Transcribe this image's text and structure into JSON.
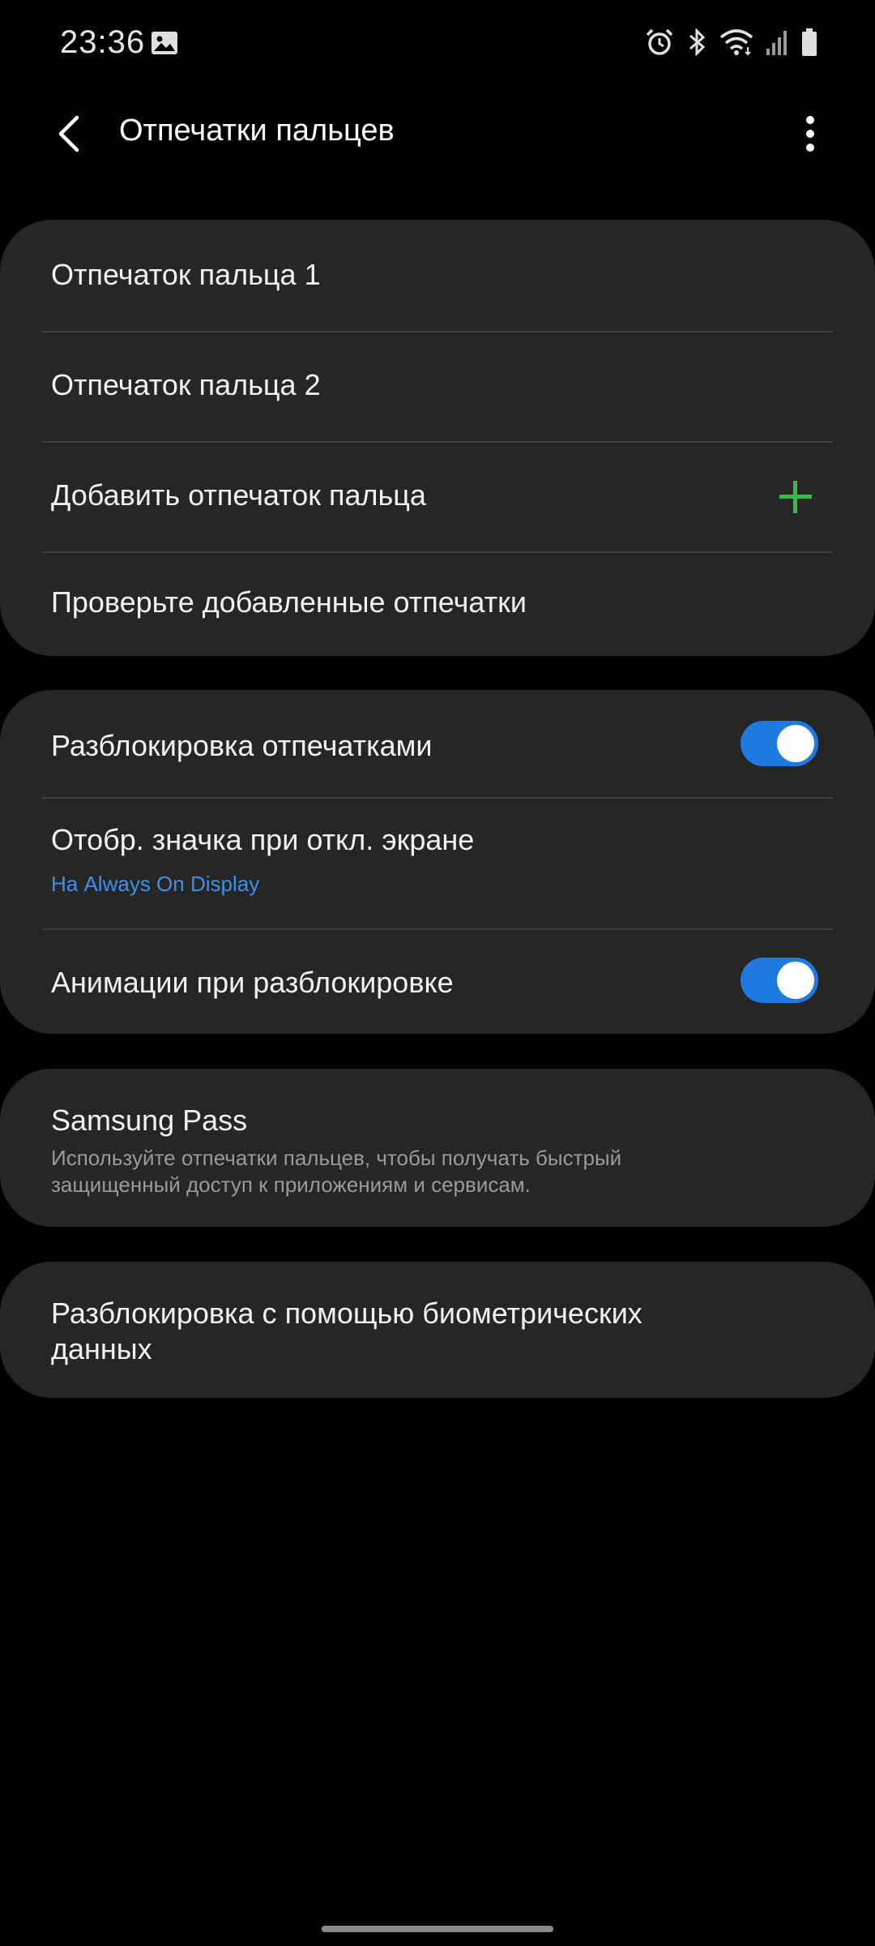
{
  "status_bar": {
    "time": "23:36",
    "icons": [
      "image-icon",
      "alarm-icon",
      "bluetooth-icon",
      "wifi-icon",
      "signal-icon",
      "battery-icon"
    ]
  },
  "header": {
    "title": "Отпечатки пальцев",
    "back_icon": "back-arrow-icon",
    "more_icon": "more-vert-icon"
  },
  "fingerprints": {
    "items": [
      {
        "label": "Отпечаток пальца 1"
      },
      {
        "label": "Отпечаток пальца 2"
      }
    ],
    "add_label": "Добавить отпечаток пальца",
    "check_label": "Проверьте добавленные отпечатки"
  },
  "unlock": {
    "fingerprint_unlock": {
      "label": "Разблокировка отпечатками",
      "enabled": true
    },
    "screen_off_icon": {
      "label": "Отобр. значка при откл. экране",
      "value": "На Always On Display"
    },
    "unlock_animation": {
      "label": "Анимации при разблокировке",
      "enabled": true
    }
  },
  "samsung_pass": {
    "title": "Samsung Pass",
    "description_line1": "Используйте отпечатки пальцев, чтобы получать быстрый",
    "description_line2": "защищенный доступ к приложениям и сервисам."
  },
  "biometrics": {
    "label_line1": "Разблокировка с помощью биометрических",
    "label_line2": "данных"
  },
  "colors": {
    "background": "#000000",
    "card": "#262626",
    "accent_blue": "#1f7ae0",
    "link_blue": "#3e91ea",
    "add_green": "#3cb54a",
    "secondary_text": "#9a9a9a"
  }
}
